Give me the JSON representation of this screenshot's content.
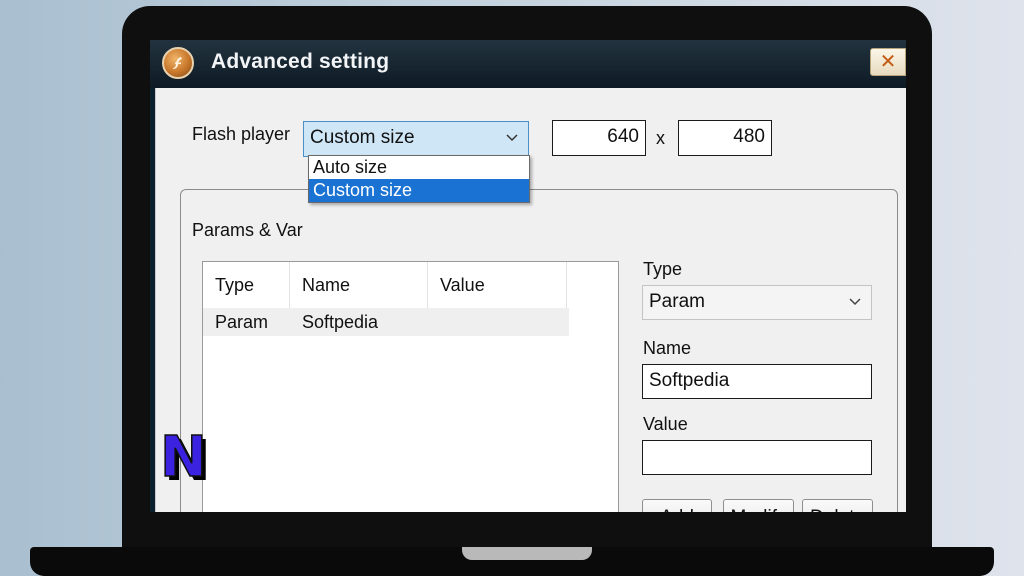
{
  "window": {
    "title": "Advanced setting",
    "close_glyph": "✕"
  },
  "flash_player": {
    "label": "Flash player",
    "selected": "Custom size",
    "width": "640",
    "separator": "x",
    "height": "480",
    "options": [
      "Auto size",
      "Custom size"
    ]
  },
  "params": {
    "group_label": "Params & Var",
    "columns": [
      "Type",
      "Name",
      "Value"
    ],
    "rows": [
      {
        "type": "Param",
        "name": "Softpedia",
        "value": ""
      }
    ]
  },
  "editor": {
    "type_label": "Type",
    "type_value": "Param",
    "name_label": "Name",
    "name_value": "Softpedia",
    "value_label": "Value",
    "value_value": "",
    "add_label": "Add",
    "modify_label": "Modify",
    "delete_label": "Delete"
  },
  "watermark": {
    "letter": "N",
    "color": "#3a22e0"
  },
  "colors": {
    "titlebar": "#0d1a24",
    "selection": "#1a73d2",
    "focused_combo": "#cfe6f7"
  }
}
